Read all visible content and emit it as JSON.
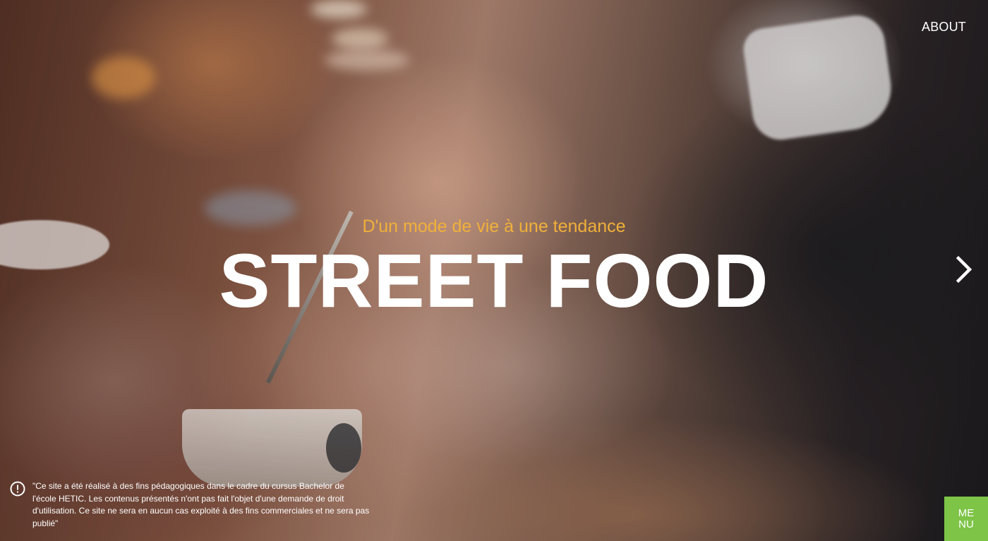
{
  "nav": {
    "about_label": "ABOUT"
  },
  "hero": {
    "subtitle": "D'un mode de vie à une tendance",
    "title": "STREET FOOD"
  },
  "notice": {
    "icon": "info-circle-icon",
    "text": "\"Ce site a été réalisé à des fins pédagogiques dans le cadre du cursus Bachelor de l'école HETIC. Les contenus présentés n'ont pas fait l'objet d'une demande de droit d'utilisation. Ce site ne sera en aucun cas exploité à des fins commerciales et ne sera pas publié\""
  },
  "menu": {
    "label": "MENU"
  },
  "icons": {
    "next": "chevron-right-icon"
  },
  "colors": {
    "accent": "#f0b03a",
    "menu_bg": "#7dc447"
  }
}
